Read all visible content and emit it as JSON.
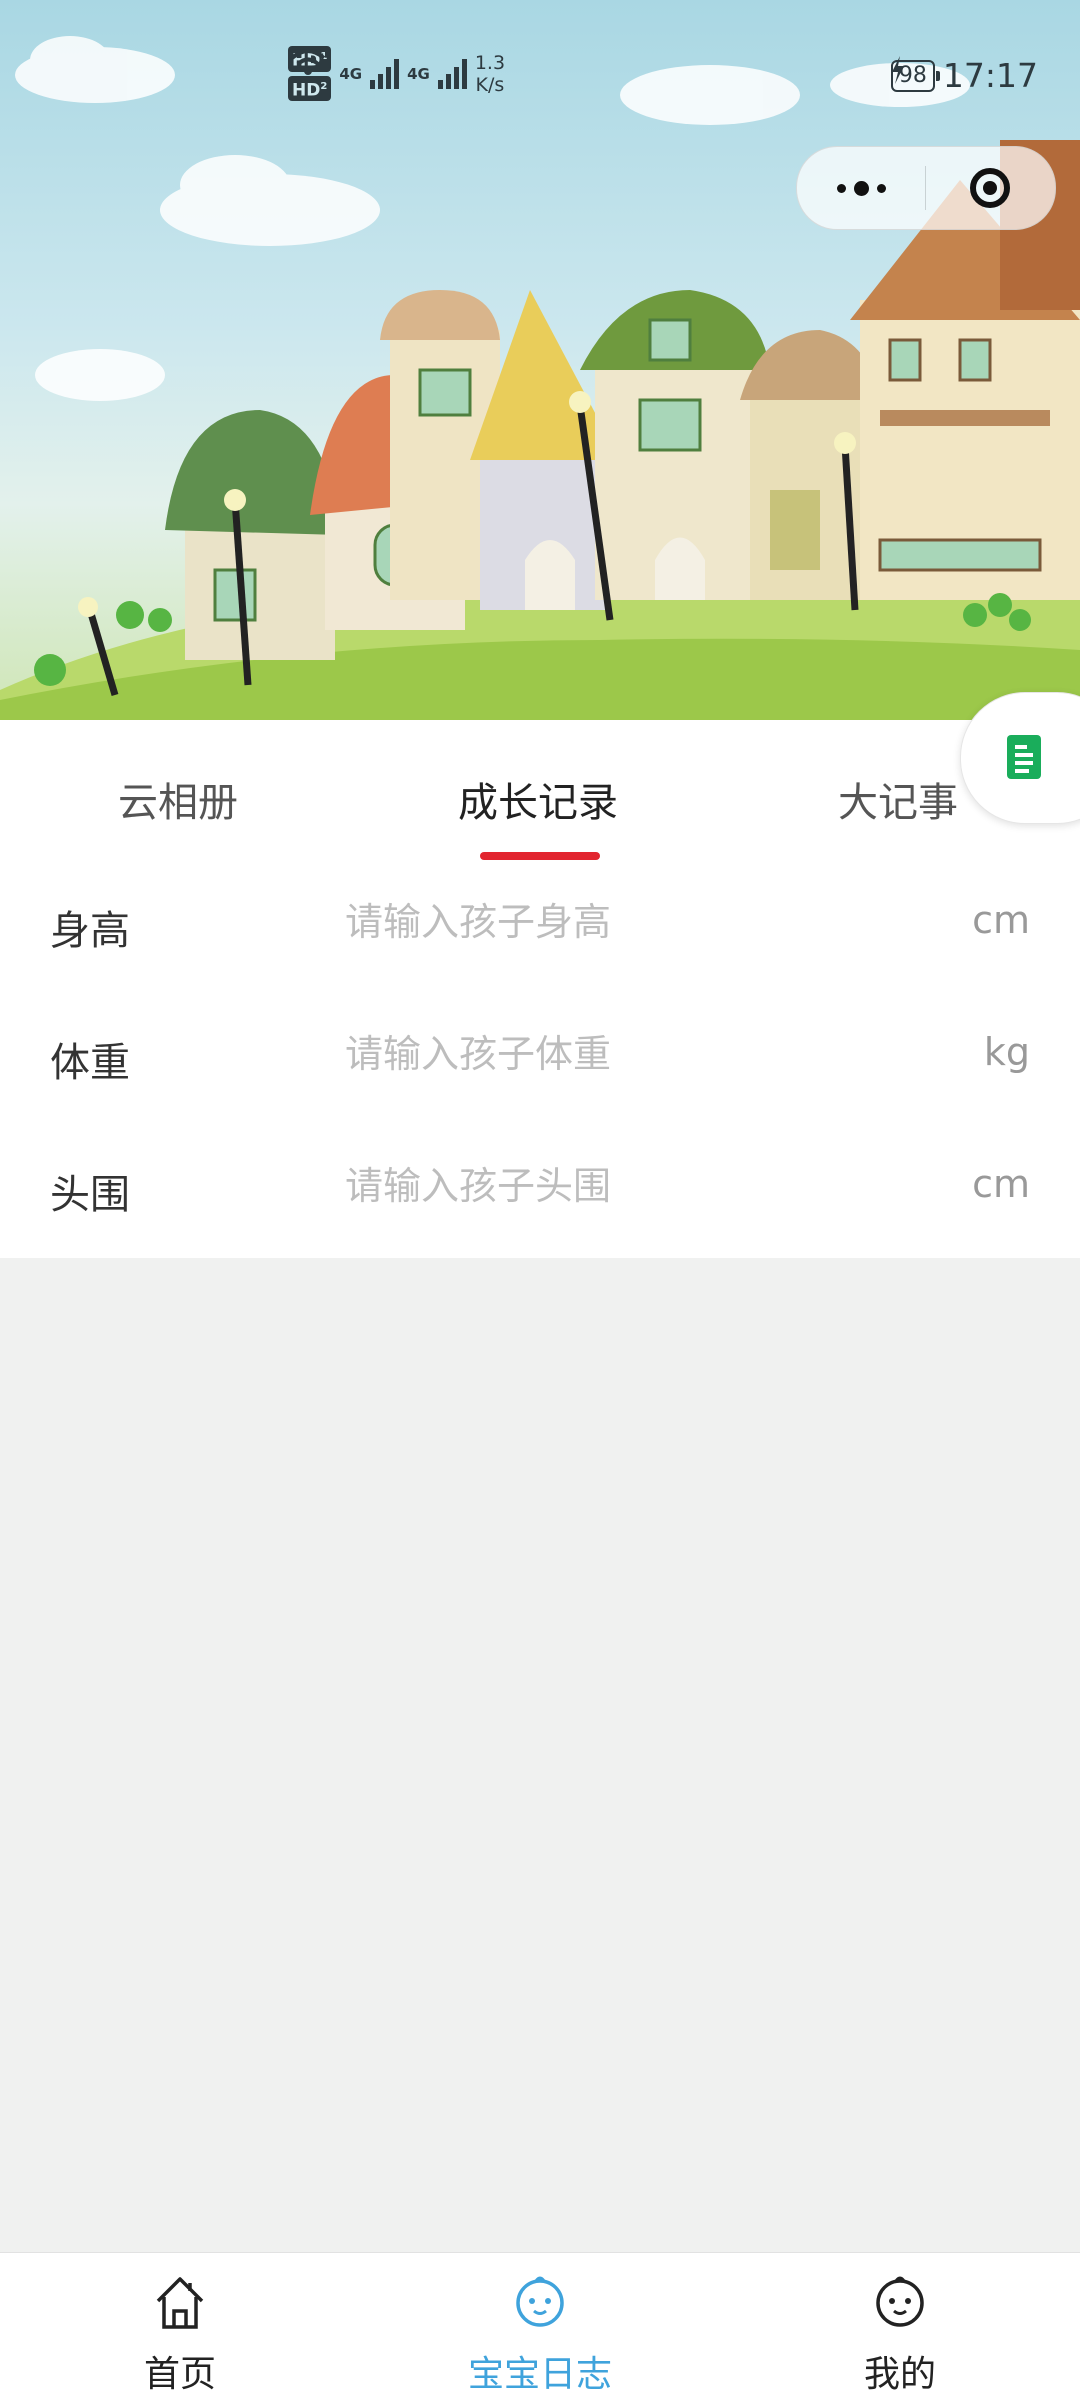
{
  "status_bar": {
    "hd1": "HD",
    "hd1_sub": "1",
    "hd2": "HD",
    "hd2_sub": "2",
    "sig1": "4G",
    "sig2": "4G",
    "speed_value": "1.3",
    "speed_unit": "K/s",
    "battery": "98",
    "time": "17:17"
  },
  "tabs": [
    {
      "label": "云相册",
      "active": false
    },
    {
      "label": "成长记录",
      "active": true
    },
    {
      "label": "大记事",
      "active": false
    }
  ],
  "form": {
    "rows": [
      {
        "label": "身高",
        "placeholder": "请输入孩子身高",
        "value": "",
        "unit": "cm"
      },
      {
        "label": "体重",
        "placeholder": "请输入孩子体重",
        "value": "",
        "unit": "kg"
      },
      {
        "label": "头围",
        "placeholder": "请输入孩子头围",
        "value": "",
        "unit": "cm"
      }
    ]
  },
  "bottom_nav": [
    {
      "label": "首页",
      "icon": "home-icon",
      "active": false
    },
    {
      "label": "宝宝日志",
      "icon": "baby-face-icon",
      "active": true
    },
    {
      "label": "我的",
      "icon": "baby-face-icon",
      "active": false
    }
  ],
  "colors": {
    "accent": "#e2252f",
    "nav_active": "#3fa3dc",
    "doc_icon": "#1aad5b",
    "page_background": "#f0f1f0"
  }
}
